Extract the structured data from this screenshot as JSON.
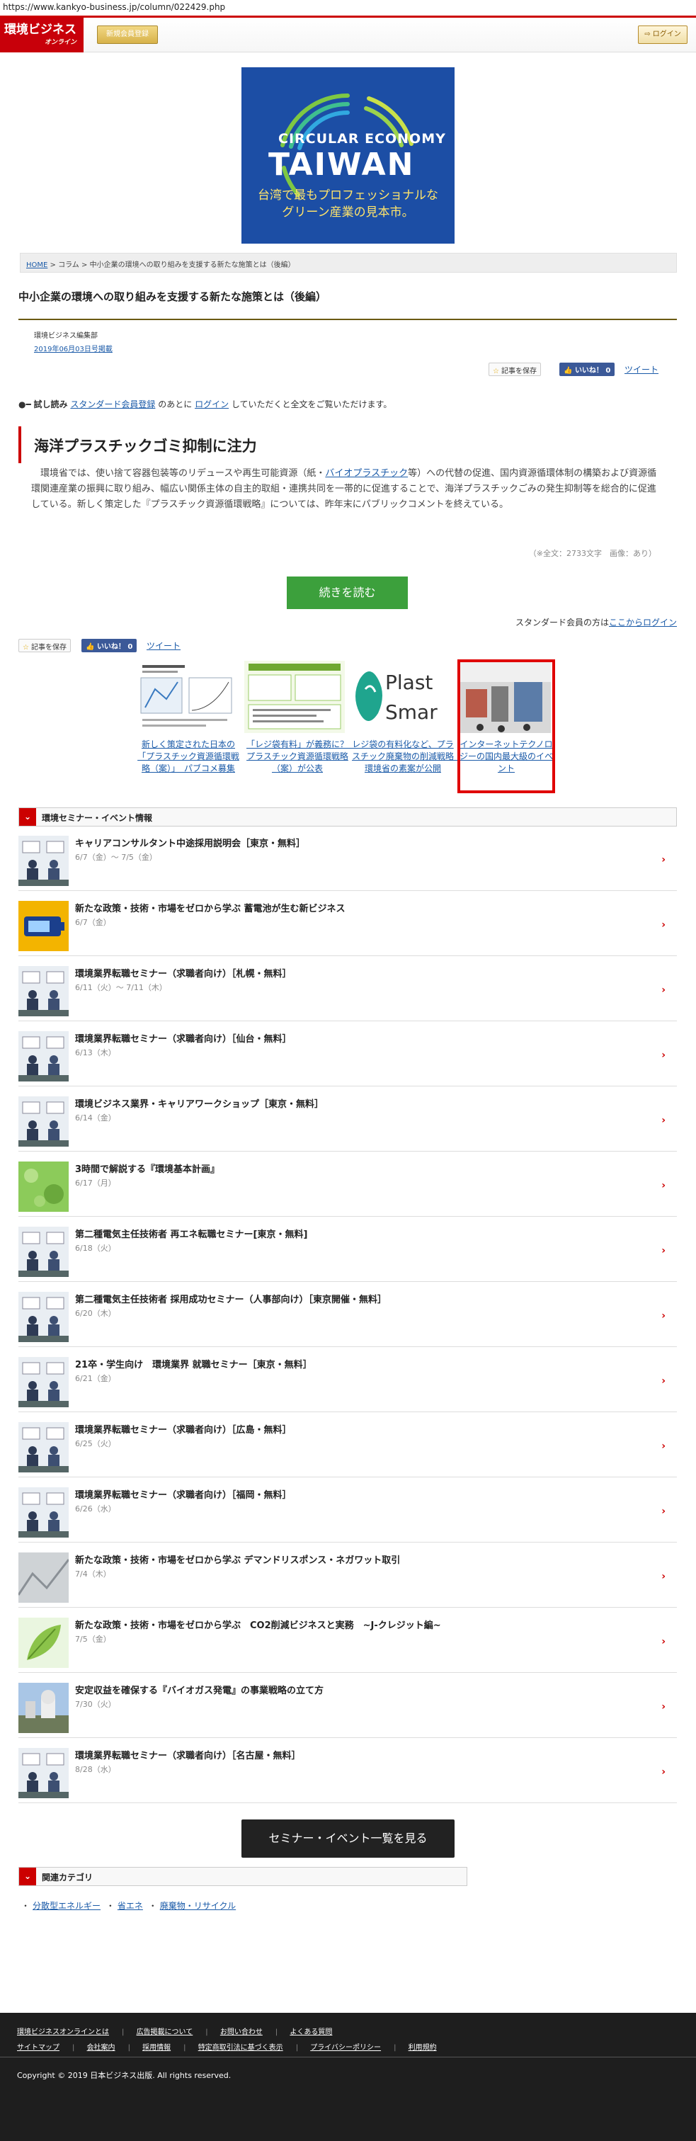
{
  "url": "https://www.kankyo-business.jp/column/022429.php",
  "header": {
    "logo_text": "環境ビジネス",
    "logo_sub": "オンライン",
    "register_label": "新規会員登録",
    "login_label": "ログイン"
  },
  "banner": {
    "line1": "CIRCULAR ECONOMY",
    "line2": "TAIWAN",
    "sub1": "台湾で最もプロフェッショナルな",
    "sub2": "グリーン産業の見本市。"
  },
  "breadcrumb": {
    "home": "HOME",
    "sep": ">",
    "column": "コラム",
    "current": "中小企業の環境への取り組みを支援する新たな施策とは（後編）"
  },
  "article": {
    "title": "中小企業の環境への取り組みを支援する新たな施策とは（後編）",
    "author": "環境ビジネス編集部",
    "date": "2019年06月03日号掲載",
    "save_label": "記事を保存",
    "like_label": "いいね！ 0",
    "tweet_label": "ツイート",
    "trial_key": "試し読み",
    "trial_link1": "スタンダード会員登録",
    "trial_mid": "のあとに",
    "trial_link2": "ログイン",
    "trial_tail": "していただくと全文をご覧いただけます。",
    "section_heading": "海洋プラスチックゴミ抑制に注力",
    "lede_before": "環境省では、使い捨て容器包装等のリデュースや再生可能資源（紙・",
    "lede_link": "バイオプラスチック",
    "lede_after": "等）への代替の促進、国内資源循環体制の構築および資源循環関連産業の振興に取り組み、幅広い関係主体の自主的取組・連携共同を一帯的に促進することで、海洋プラスチックごみの発生抑制等を総合的に促進している。新しく策定した『プラスチック資源循環戦略』については、昨年末にパブリックコメントを終えている。",
    "char_count": "（※全文：2733文字　画像：あり）",
    "read_more_label": "続きを読む",
    "std_login_text": "スタンダード会員の方は",
    "std_login_link": "ここからログイン"
  },
  "related": [
    {
      "text": "新しく策定された日本の「プラスチック資源循環戦略（案）」　パブコメ募集"
    },
    {
      "text": "「レジ袋有料」が義務に？　プラスチック資源循環戦略（案）が公表"
    },
    {
      "text": "レジ袋の有料化など、プラスチック廃棄物の削減戦略　環境省の素案が公開",
      "thumb_word1": "Plast",
      "thumb_word2": "Smar"
    },
    {
      "text": "インターネットテクノロジーの国内最大級のイベント"
    }
  ],
  "events_box": {
    "heading": "環境セミナー・イベント情報",
    "items": [
      {
        "title": "キャリアコンサルタント中途採用説明会［東京・無料］",
        "date": "6/7（金）～ 7/5（金）",
        "thumb": "office"
      },
      {
        "title": "新たな政策・技術・市場をゼロから学ぶ 蓄電池が生む新ビジネス",
        "date": "6/7（金）",
        "thumb": "battery"
      },
      {
        "title": "環境業界転職セミナー（求職者向け）［札幌・無料］",
        "date": "6/11（火）～ 7/11（木）",
        "thumb": "office"
      },
      {
        "title": "環境業界転職セミナー（求職者向け）［仙台・無料］",
        "date": "6/13（木）",
        "thumb": "office"
      },
      {
        "title": "環境ビジネス業界・キャリアワークショップ［東京・無料］",
        "date": "6/14（金）",
        "thumb": "office"
      },
      {
        "title": "3時間で解説する『環境基本計画』",
        "date": "6/17（月）",
        "thumb": "green"
      },
      {
        "title": "第二種電気主任技術者 再エネ転職セミナー[東京・無料]",
        "date": "6/18（火）",
        "thumb": "office"
      },
      {
        "title": "第二種電気主任技術者 採用成功セミナー（人事部向け）［東京開催・無料］",
        "date": "6/20（木）",
        "thumb": "office"
      },
      {
        "title": "21卒・学生向け　環境業界 就職セミナー［東京・無料］",
        "date": "6/21（金）",
        "thumb": "office"
      },
      {
        "title": "環境業界転職セミナー（求職者向け）［広島・無料］",
        "date": "6/25（火）",
        "thumb": "office"
      },
      {
        "title": "環境業界転職セミナー（求職者向け）［福岡・無料］",
        "date": "6/26（水）",
        "thumb": "office"
      },
      {
        "title": "新たな政策・技術・市場をゼロから学ぶ デマンドリスポンス・ネガワット取引",
        "date": "7/4（木）",
        "thumb": "gray"
      },
      {
        "title": "新たな政策・技術・市場をゼロから学ぶ　CO2削減ビジネスと実務　~J-クレジット編~",
        "date": "7/5（金）",
        "thumb": "leaf"
      },
      {
        "title": "安定収益を確保する『バイオガス発電』の事業戦略の立て方",
        "date": "7/30（火）",
        "thumb": "plant"
      },
      {
        "title": "環境業界転職セミナー（求職者向け）［名古屋・無料］",
        "date": "8/28（水）",
        "thumb": "office"
      }
    ],
    "all_label": "セミナー・イベント一覧を見る"
  },
  "categories": {
    "heading": "関連カテゴリ",
    "items": [
      "分散型エネルギー",
      "省エネ",
      "廃棄物・リサイクル"
    ]
  },
  "footer": {
    "row1": [
      "環境ビジネスオンラインとは",
      "広告掲載について",
      "お問い合わせ",
      "よくある質問"
    ],
    "row2": [
      "サイトマップ",
      "会社案内",
      "採用情報",
      "特定商取引法に基づく表示",
      "プライバシーポリシー",
      "利用規約"
    ],
    "copyright": "Copyright © 2019 日本ビジネス出版. All rights reserved."
  },
  "colors": {
    "brand_red": "#c8000a",
    "accent_green": "#3ca03c",
    "link_blue": "#1a5aa8",
    "footer_bg": "#1e1e1e"
  }
}
